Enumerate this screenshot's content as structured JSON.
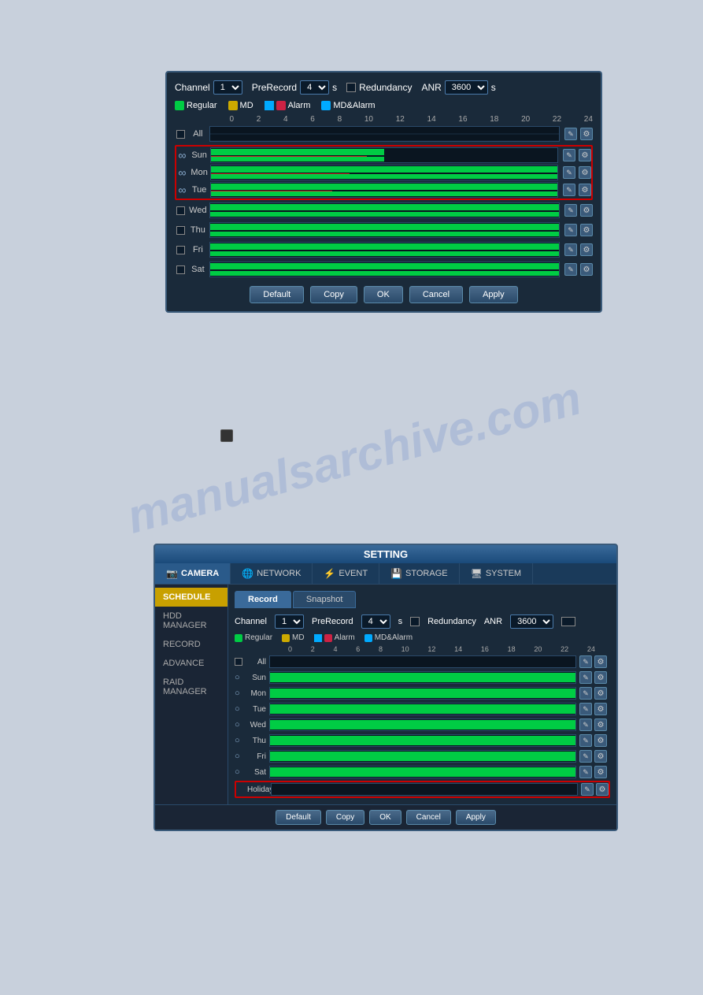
{
  "topDialog": {
    "channelLabel": "Channel",
    "channelValue": "1",
    "preRecordLabel": "PreRecord",
    "preRecordValue": "4",
    "preRecordUnit": "s",
    "redundancyLabel": "Redundancy",
    "anrLabel": "ANR",
    "anrValue": "3600",
    "anrUnit": "s",
    "legend": {
      "regular": "Regular",
      "md": "MD",
      "alarm": "Alarm",
      "mdAlarm": "MD&Alarm"
    },
    "timeLabels": [
      "0",
      "2",
      "4",
      "6",
      "8",
      "10",
      "12",
      "14",
      "16",
      "18",
      "20",
      "22",
      "24"
    ],
    "days": [
      {
        "label": "All",
        "hasCheck": true,
        "checked": false,
        "hasGreen": false,
        "hasRed": false
      },
      {
        "label": "Sun",
        "hasCheck": true,
        "linked": true,
        "hasGreen": true,
        "hasRed": true
      },
      {
        "label": "Mon",
        "hasCheck": true,
        "linked": true,
        "hasGreen": true,
        "hasRed": true
      },
      {
        "label": "Tue",
        "hasCheck": true,
        "linked": true,
        "hasGreen": true,
        "hasRed": true
      },
      {
        "label": "Wed",
        "hasCheck": true,
        "checked": false,
        "hasGreen": true,
        "hasRed": false
      },
      {
        "label": "Thu",
        "hasCheck": true,
        "checked": false,
        "hasGreen": true,
        "hasRed": false
      },
      {
        "label": "Fri",
        "hasCheck": true,
        "checked": false,
        "hasGreen": true,
        "hasRed": false
      },
      {
        "label": "Sat",
        "hasCheck": true,
        "checked": false,
        "hasGreen": true,
        "hasRed": false
      }
    ],
    "buttons": {
      "default": "Default",
      "copy": "Copy",
      "ok": "OK",
      "cancel": "Cancel",
      "apply": "Apply"
    }
  },
  "bottomDialog": {
    "title": "SETTING",
    "navTabs": [
      {
        "label": "CAMERA",
        "active": true
      },
      {
        "label": "NETWORK",
        "active": false
      },
      {
        "label": "EVENT",
        "active": false
      },
      {
        "label": "STORAGE",
        "active": false
      },
      {
        "label": "SYSTEM",
        "active": false
      }
    ],
    "sidebarItems": [
      {
        "label": "SCHEDULE",
        "active": true
      },
      {
        "label": "HDD MANAGER",
        "active": false
      },
      {
        "label": "RECORD",
        "active": false
      },
      {
        "label": "ADVANCE",
        "active": false
      },
      {
        "label": "RAID MANAGER",
        "active": false
      }
    ],
    "subTabs": [
      {
        "label": "Record",
        "active": true
      },
      {
        "label": "Snapshot",
        "active": false
      }
    ],
    "channelLabel": "Channel",
    "channelValue": "1",
    "preRecordLabel": "PreRecord",
    "preRecordValue": "4",
    "preRecordUnit": "s",
    "redundancyLabel": "Redundancy",
    "anrLabel": "ANR",
    "anrValue": "3600",
    "legend": {
      "regular": "Regular",
      "md": "MD",
      "alarm": "Alarm",
      "mdAlarm": "MD&Alarm"
    },
    "timeLabels": [
      "0",
      "2",
      "4",
      "6",
      "8",
      "10",
      "12",
      "14",
      "16",
      "18",
      "20",
      "22",
      "24"
    ],
    "days": [
      {
        "label": "All"
      },
      {
        "label": "Sun"
      },
      {
        "label": "Mon"
      },
      {
        "label": "Tue"
      },
      {
        "label": "Wed"
      },
      {
        "label": "Thu"
      },
      {
        "label": "Fri"
      },
      {
        "label": "Sat"
      },
      {
        "label": "Holiday",
        "isHoliday": true
      }
    ],
    "buttons": {
      "default": "Default",
      "copy": "Copy",
      "ok": "OK",
      "cancel": "Cancel",
      "apply": "Apply"
    }
  },
  "watermark": "manualsarchive.com"
}
